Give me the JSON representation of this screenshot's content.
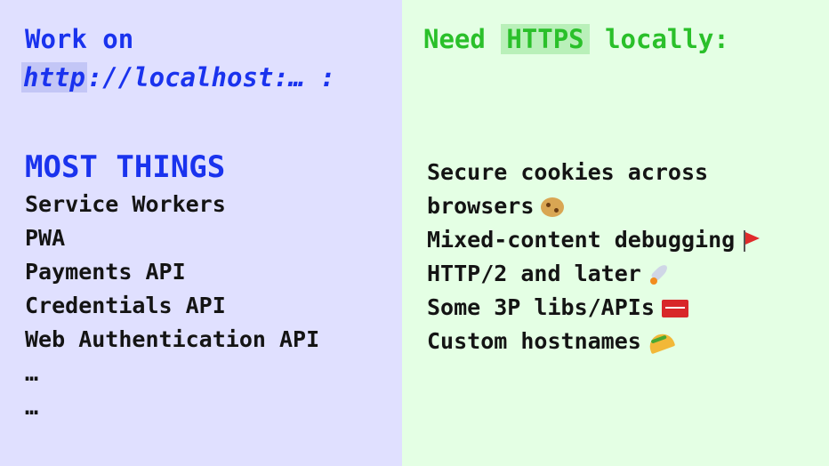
{
  "left": {
    "title_line1": "Work on",
    "title_line2_highlight": "http",
    "title_line2_rest": "://localhost:… :",
    "heading": "MOST THINGS",
    "items": [
      "Service Workers",
      "PWA",
      "Payments API",
      "Credentials API",
      "Web Authentication API",
      "…",
      "…"
    ]
  },
  "right": {
    "title_prefix": "Need",
    "title_highlight": "HTTPS",
    "title_suffix": "locally:",
    "items": [
      {
        "text": "Secure cookies across",
        "emoji": ""
      },
      {
        "text": "browsers",
        "emoji": "cookie"
      },
      {
        "text": "Mixed-content debugging",
        "emoji": "flag"
      },
      {
        "text": "HTTP/2 and later",
        "emoji": "rocket"
      },
      {
        "text": "Some 3P libs/APIs",
        "emoji": "toolbox"
      },
      {
        "text": "Custom hostnames",
        "emoji": "taco"
      }
    ]
  },
  "colors": {
    "left_bg": "#e0e0ff",
    "right_bg": "#e4ffe4",
    "blue_text": "#1a33ee",
    "green_text": "#2ac02a",
    "body_text": "#141414",
    "blue_highlight": "#c3c6f6",
    "green_highlight": "#b9f0b9"
  }
}
